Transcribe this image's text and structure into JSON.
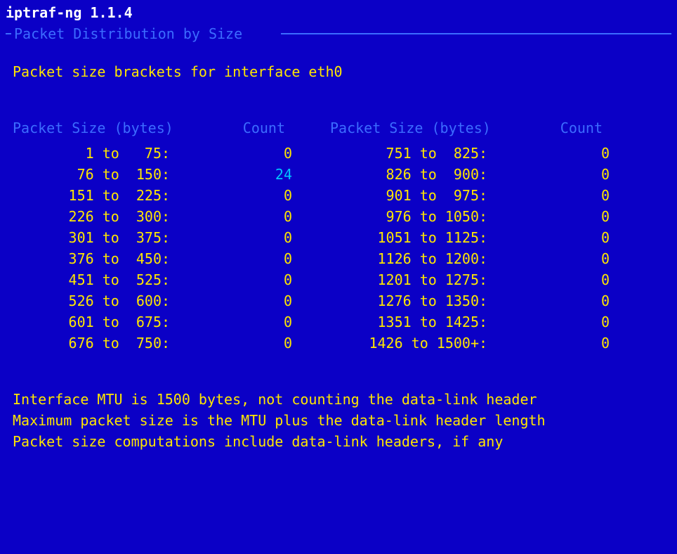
{
  "title": "iptraf-ng 1.1.4",
  "frame_title": " Packet Distribution by Size ",
  "subtitle": "Packet size brackets for interface eth0",
  "col_hdr_size": "Packet Size (bytes)",
  "col_hdr_count": "Count",
  "left": [
    {
      "lo": 1,
      "hi": 75,
      "label": "   1 to   75",
      "count": 0,
      "hi_count": false
    },
    {
      "lo": 76,
      "hi": 150,
      "label": "  76 to  150",
      "count": 24,
      "hi_count": true
    },
    {
      "lo": 151,
      "hi": 225,
      "label": " 151 to  225",
      "count": 0,
      "hi_count": false
    },
    {
      "lo": 226,
      "hi": 300,
      "label": " 226 to  300",
      "count": 0,
      "hi_count": false
    },
    {
      "lo": 301,
      "hi": 375,
      "label": " 301 to  375",
      "count": 0,
      "hi_count": false
    },
    {
      "lo": 376,
      "hi": 450,
      "label": " 376 to  450",
      "count": 0,
      "hi_count": false
    },
    {
      "lo": 451,
      "hi": 525,
      "label": " 451 to  525",
      "count": 0,
      "hi_count": false
    },
    {
      "lo": 526,
      "hi": 600,
      "label": " 526 to  600",
      "count": 0,
      "hi_count": false
    },
    {
      "lo": 601,
      "hi": 675,
      "label": " 601 to  675",
      "count": 0,
      "hi_count": false
    },
    {
      "lo": 676,
      "hi": 750,
      "label": " 676 to  750",
      "count": 0,
      "hi_count": false
    }
  ],
  "right": [
    {
      "lo": 751,
      "hi": 825,
      "label": " 751 to  825",
      "count": 0,
      "hi_count": false
    },
    {
      "lo": 826,
      "hi": 900,
      "label": " 826 to  900",
      "count": 0,
      "hi_count": false
    },
    {
      "lo": 901,
      "hi": 975,
      "label": " 901 to  975",
      "count": 0,
      "hi_count": false
    },
    {
      "lo": 976,
      "hi": 1050,
      "label": " 976 to 1050",
      "count": 0,
      "hi_count": false
    },
    {
      "lo": 1051,
      "hi": 1125,
      "label": "1051 to 1125",
      "count": 0,
      "hi_count": false
    },
    {
      "lo": 1126,
      "hi": 1200,
      "label": "1126 to 1200",
      "count": 0,
      "hi_count": false
    },
    {
      "lo": 1201,
      "hi": 1275,
      "label": "1201 to 1275",
      "count": 0,
      "hi_count": false
    },
    {
      "lo": 1276,
      "hi": 1350,
      "label": "1276 to 1350",
      "count": 0,
      "hi_count": false
    },
    {
      "lo": 1351,
      "hi": 1425,
      "label": "1351 to 1425",
      "count": 0,
      "hi_count": false
    },
    {
      "lo": 1426,
      "hi": 1500,
      "label": "1426 to 1500+",
      "count": 0,
      "hi_count": false
    }
  ],
  "notes": [
    "Interface MTU is 1500 bytes, not counting the data-link header",
    "Maximum packet size is the MTU plus the data-link header length",
    "Packet size computations include data-link headers, if any"
  ],
  "chart_data": {
    "type": "table",
    "title": "Packet Distribution by Size",
    "interface": "eth0",
    "mtu": 1500,
    "brackets": [
      {
        "from": 1,
        "to": 75,
        "count": 0
      },
      {
        "from": 76,
        "to": 150,
        "count": 24
      },
      {
        "from": 151,
        "to": 225,
        "count": 0
      },
      {
        "from": 226,
        "to": 300,
        "count": 0
      },
      {
        "from": 301,
        "to": 375,
        "count": 0
      },
      {
        "from": 376,
        "to": 450,
        "count": 0
      },
      {
        "from": 451,
        "to": 525,
        "count": 0
      },
      {
        "from": 526,
        "to": 600,
        "count": 0
      },
      {
        "from": 601,
        "to": 675,
        "count": 0
      },
      {
        "from": 676,
        "to": 750,
        "count": 0
      },
      {
        "from": 751,
        "to": 825,
        "count": 0
      },
      {
        "from": 826,
        "to": 900,
        "count": 0
      },
      {
        "from": 901,
        "to": 975,
        "count": 0
      },
      {
        "from": 976,
        "to": 1050,
        "count": 0
      },
      {
        "from": 1051,
        "to": 1125,
        "count": 0
      },
      {
        "from": 1126,
        "to": 1200,
        "count": 0
      },
      {
        "from": 1201,
        "to": 1275,
        "count": 0
      },
      {
        "from": 1276,
        "to": 1350,
        "count": 0
      },
      {
        "from": 1351,
        "to": 1425,
        "count": 0
      },
      {
        "from": 1426,
        "to": "1500+",
        "count": 0
      }
    ]
  }
}
